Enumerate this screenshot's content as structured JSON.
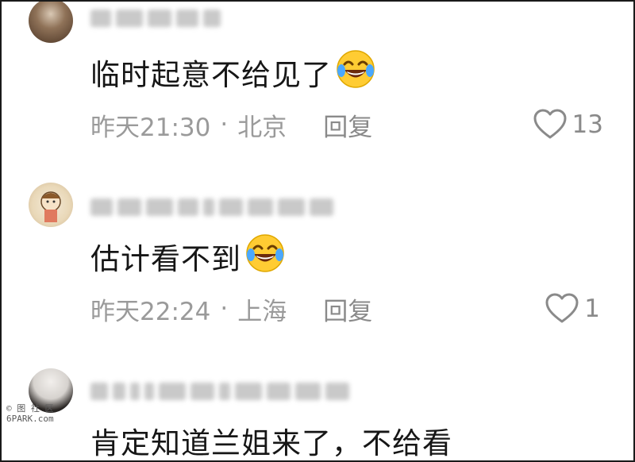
{
  "comments": [
    {
      "text": "临时起意不给见了",
      "emoji": "laughing-crying-emoji",
      "time": "昨天21:30",
      "separator": "·",
      "location": "北京",
      "reply_label": "回复",
      "likes": "13"
    },
    {
      "text": "估计看不到",
      "emoji": "laughing-crying-emoji",
      "time": "昨天22:24",
      "separator": "·",
      "location": "上海",
      "reply_label": "回复",
      "likes": "1"
    },
    {
      "text": "肯定知道兰姐来了，不给看"
    }
  ],
  "watermark": {
    "line1": "© 图 社 区",
    "line2": "6PARK.com"
  },
  "colors": {
    "text": "#161616",
    "meta": "#9a9a9a",
    "emoji_face": "#ffcc33"
  }
}
